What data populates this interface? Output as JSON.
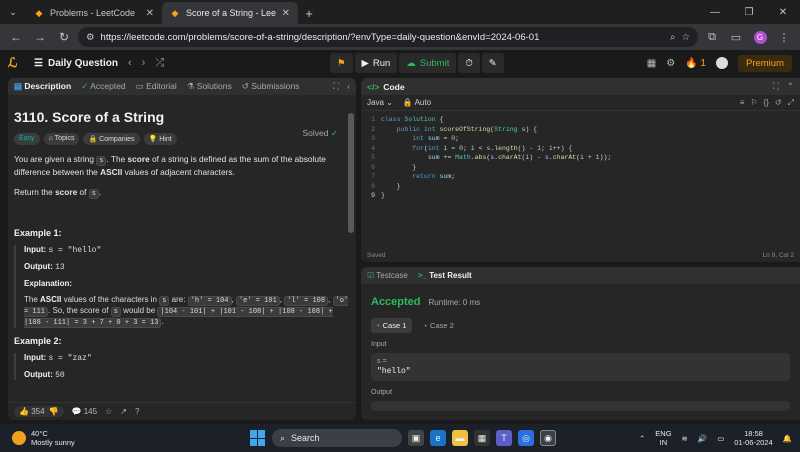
{
  "browser": {
    "tabs": [
      {
        "title": "Problems - LeetCode",
        "active": false
      },
      {
        "title": "Score of a String - LeetCode",
        "active": true
      }
    ],
    "url": "https://leetcode.com/problems/score-of-a-string/description/?envType=daily-question&envId=2024-06-01",
    "profile_initial": "G"
  },
  "header": {
    "list_label": "Daily Question",
    "run_label": "Run",
    "submit_label": "Submit",
    "streak": "1",
    "premium_label": "Premium"
  },
  "left_panel": {
    "tabs": [
      "Description",
      "Accepted",
      "Editorial",
      "Solutions",
      "Submissions"
    ],
    "title": "3110. Score of a String",
    "solved_label": "Solved",
    "chips": [
      "Easy",
      "Topics",
      "Companies",
      "Hint"
    ],
    "para1_a": "You are given a string",
    "para1_code": "s",
    "para1_b": ". The",
    "para1_bold": "score",
    "para1_c": "of a string is defined as the sum of the absolute difference between the",
    "para1_bold2": "ASCII",
    "para1_d": "values of adjacent characters.",
    "para2_a": "Return the",
    "para2_bold": "score",
    "para2_b": "of",
    "para2_code": "s",
    "ex1_title": "Example 1:",
    "ex1_input_label": "Input:",
    "ex1_input": "s = \"hello\"",
    "ex1_output_label": "Output:",
    "ex1_output": "13",
    "ex1_expl_label": "Explanation:",
    "ex1_expl_a": "The",
    "ex1_expl_bold": "ASCII",
    "ex1_expl_b": "values of the characters in",
    "ex1_expl_code1": "s",
    "ex1_expl_c": "are:",
    "ex1_expl_h": "'h' = 104",
    "ex1_expl_e": "'e' = 101",
    "ex1_expl_l": "'l' = 108",
    "ex1_expl_o": "'o' = 111",
    "ex1_expl_d": ". So, the score of",
    "ex1_expl_code2": "s",
    "ex1_expl_e2": "would be",
    "ex1_expl_calc": "|104 - 101| + |101 - 108| + |108 - 108| + |108 - 111| = 3 + 7 + 0 + 3 = 13",
    "ex2_title": "Example 2:",
    "ex2_input_label": "Input:",
    "ex2_input": "s = \"zaz\"",
    "ex2_output_label": "Output:",
    "ex2_output": "50",
    "likes": "354",
    "comments": "145"
  },
  "code_panel": {
    "title": "Code",
    "language": "Java",
    "auto_label": "Auto",
    "lines": [
      "1",
      "2",
      "3",
      "4",
      "5",
      "6",
      "7",
      "8",
      "9"
    ],
    "status_left": "Saved",
    "status_right": "Ln 9, Col 2"
  },
  "test_panel": {
    "tabs": [
      "Testcase",
      "Test Result"
    ],
    "status": "Accepted",
    "runtime": "Runtime: 0 ms",
    "cases": [
      "Case 1",
      "Case 2"
    ],
    "input_label": "Input",
    "var_name": "s =",
    "var_value": "\"hello\"",
    "output_label": "Output"
  },
  "taskbar": {
    "temperature": "40°C",
    "weather": "Mostly sunny",
    "search_label": "Search",
    "lang_top": "ENG",
    "lang_bottom": "IN",
    "time": "18:58",
    "date": "01-06-2024"
  }
}
